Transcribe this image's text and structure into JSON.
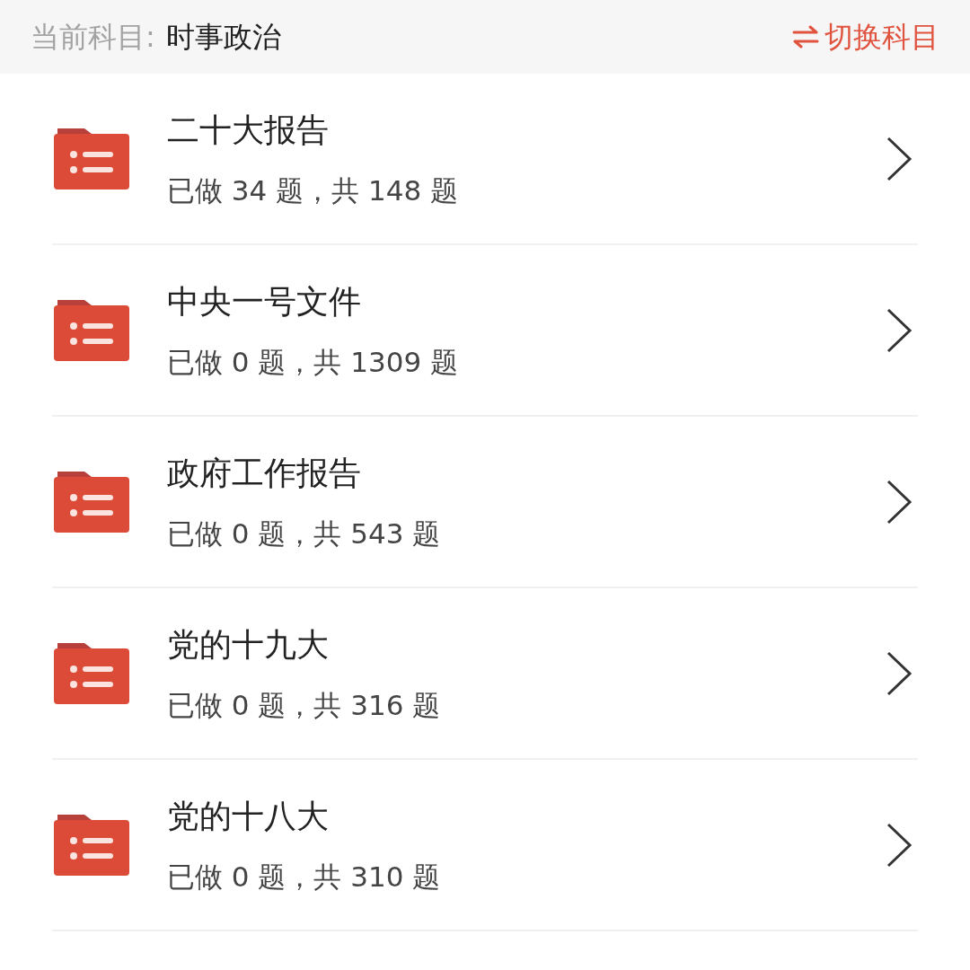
{
  "header": {
    "label": "当前科目:",
    "subject": "时事政治",
    "switch_button": "切换科目"
  },
  "items": [
    {
      "title": "二十大报告",
      "progress": "已做 34 题，共 148 题"
    },
    {
      "title": "中央一号文件",
      "progress": "已做 0 题，共 1309 题"
    },
    {
      "title": "政府工作报告",
      "progress": "已做 0 题，共 543 题"
    },
    {
      "title": "党的十九大",
      "progress": "已做 0 题，共 316 题"
    },
    {
      "title": "党的十八大",
      "progress": "已做 0 题，共 310 题"
    }
  ]
}
